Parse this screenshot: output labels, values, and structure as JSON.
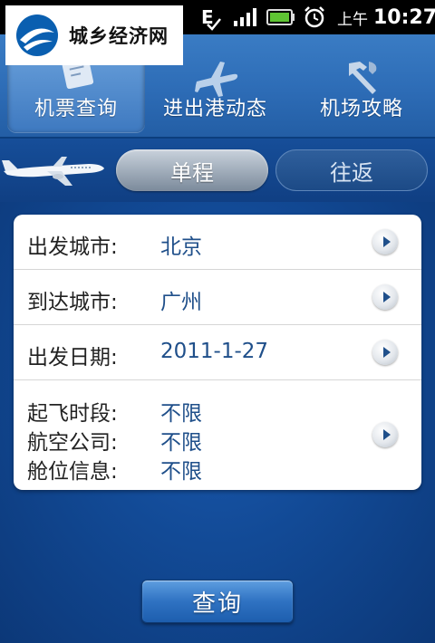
{
  "status_bar": {
    "network_type": "E",
    "am_pm": "上午",
    "time": "10:27"
  },
  "logo": {
    "text": "城乡经济网"
  },
  "top_nav": {
    "tabs": [
      {
        "label": "机票查询",
        "icon": "ticket-icon",
        "active": true
      },
      {
        "label": "进出港动态",
        "icon": "airplane-icon",
        "active": false
      },
      {
        "label": "机场攻略",
        "icon": "tools-icon",
        "active": false
      }
    ]
  },
  "trip_type": {
    "one_way": "单程",
    "round_trip": "往返",
    "selected": "单程"
  },
  "form": {
    "departure_city": {
      "label": "出发城市:",
      "value": "北京"
    },
    "arrival_city": {
      "label": "到达城市:",
      "value": "广州"
    },
    "departure_date": {
      "label": "出发日期:",
      "value": "2011-1-27"
    },
    "time_slot": {
      "label": "起飞时段:",
      "value": "不限"
    },
    "airline": {
      "label": "航空公司:",
      "value": "不限"
    },
    "cabin_class": {
      "label": "舱位信息:",
      "value": "不限"
    }
  },
  "query_button": {
    "label": "查询"
  },
  "colors": {
    "nav_blue": "#2d6cb6",
    "background_blue": "#124a96",
    "value_blue": "#1f4f8a"
  }
}
